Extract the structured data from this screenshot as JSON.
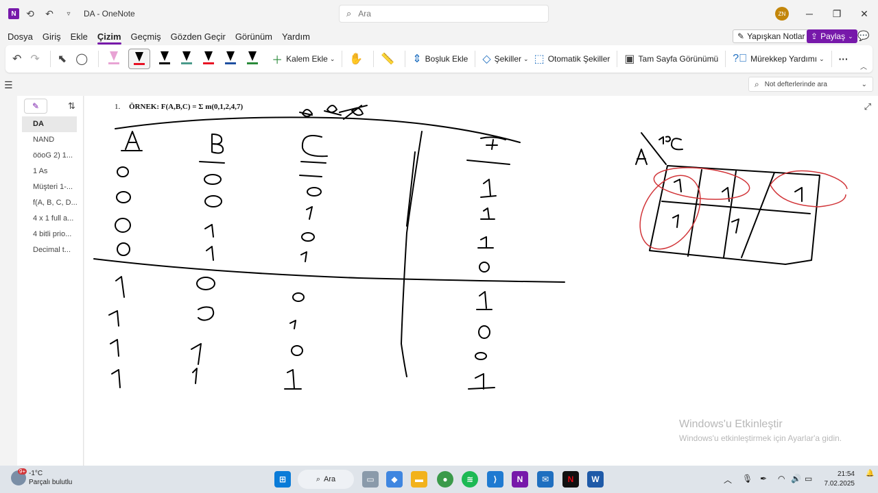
{
  "window": {
    "title": "DA  -  OneNote",
    "search_placeholder": "Ara",
    "avatar_initials": "ZN"
  },
  "menu": {
    "items": [
      "Dosya",
      "Giriş",
      "Ekle",
      "Çizim",
      "Geçmiş",
      "Gözden Geçir",
      "Görünüm",
      "Yardım"
    ],
    "active": "Çizim",
    "sticky_notes": "Yapışkan Notlar",
    "share": "Paylaş"
  },
  "ribbon": {
    "add_pen": "Kalem Ekle",
    "add_space": "Boşluk Ekle",
    "shapes": "Şekiller",
    "auto_shapes": "Otomatik Şekiller",
    "full_page_view": "Tam Sayfa Görünümü",
    "ink_help": "Mürekkep Yardımı",
    "more": "···",
    "pens": [
      {
        "color": "#e8a3d4",
        "kind": "highlighter"
      },
      {
        "color": "#e81123",
        "kind": "pen",
        "selected": true
      },
      {
        "color": "#000000",
        "kind": "pen"
      },
      {
        "color": "#4a9a8a",
        "kind": "pen"
      },
      {
        "color": "#e81123",
        "kind": "pen"
      },
      {
        "color": "#1f4fa0",
        "kind": "pen"
      },
      {
        "color": "#2a8a3a",
        "kind": "pen"
      }
    ]
  },
  "notes_search": {
    "placeholder": "Not defterlerinde ara"
  },
  "pages": {
    "items": [
      "DA",
      "NAND",
      "ööoG 2) 1...",
      "1 As",
      "Müşteri 1-...",
      "f(A, B, C, D...",
      "4 x 1 full a...",
      "4 bitli prio...",
      "Decimal t..."
    ],
    "selected": "DA"
  },
  "canvas": {
    "example_number": "1.",
    "example_text": "ÖRNEK: F(A,B,C) = Σ m(0,1,2,4,7)",
    "ink_color": "#000000",
    "highlight_ink": "#d13438"
  },
  "watermark": {
    "line1": "Windows'u Etkinleştir",
    "line2": "Windows'u etkinleştirmek için Ayarlar'a gidin."
  },
  "taskbar": {
    "weather_temp": "-1°C",
    "weather_desc": "Parçalı bulutlu",
    "weather_badge": "9+",
    "search_label": "Ara",
    "time": "21:54",
    "date": "7.02.2025"
  }
}
